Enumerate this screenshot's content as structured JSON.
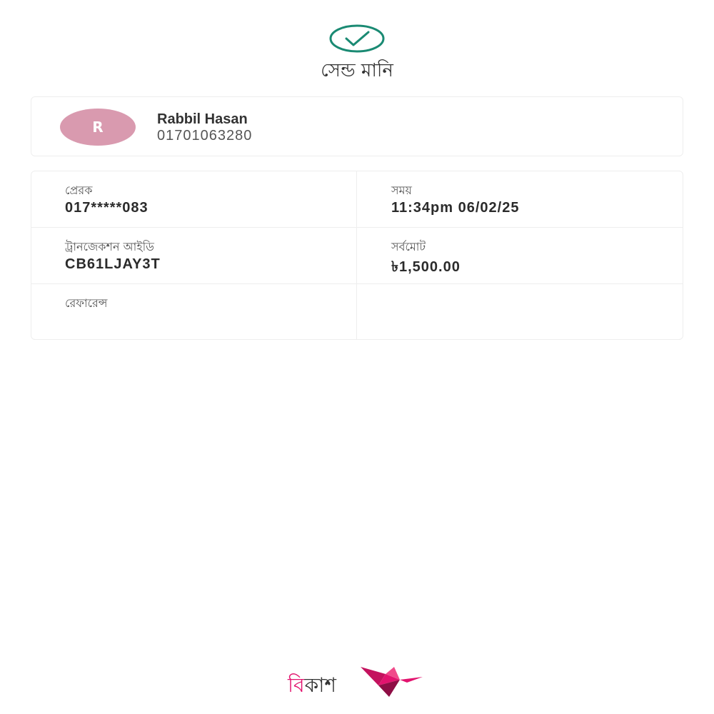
{
  "header": {
    "status_icon": "check-circle-icon",
    "title": "সেন্ড মানি"
  },
  "recipient": {
    "avatar_initial": "R",
    "avatar_color": "#d99aaf",
    "name": "Rabbil Hasan",
    "number": "01701063280"
  },
  "details": {
    "sender_label": "প্রেরক",
    "sender_value": "017*****083",
    "time_label": "সময়",
    "time_value": "11:34pm 06/02/25",
    "trx_label": "ট্রানজেকশন আইডি",
    "trx_value": "CB61LJAY3T",
    "total_label": "সর্বমোট",
    "total_value": "৳1,500.00",
    "reference_label": "রেফারেন্স",
    "reference_value": ""
  },
  "brand": {
    "logo_first": "বি",
    "logo_rest": "কাশ",
    "logo_icon": "bird-icon",
    "brand_color": "#e2136e"
  },
  "colors": {
    "success": "#1a8a73",
    "border": "#eeeeee"
  }
}
